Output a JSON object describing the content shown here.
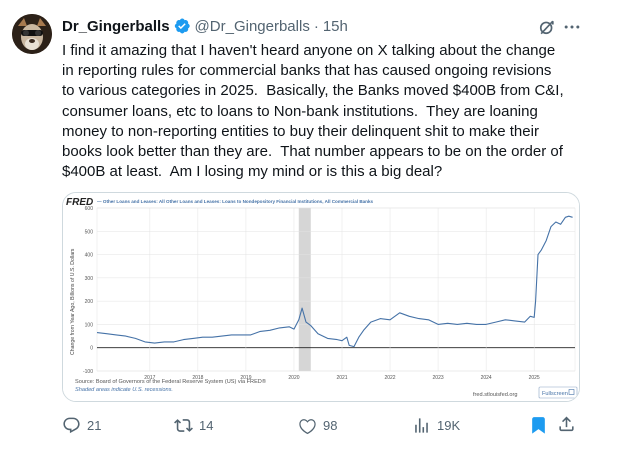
{
  "tweet": {
    "display_name": "Dr_Gingerballs",
    "handle": "@Dr_Gingerballs",
    "separator": "·",
    "time": "15h",
    "text": "I find it amazing that I haven't heard anyone on X talking about the change\nin reporting rules for commercial banks that has caused ongoing revisions\nto various categories in 2025.  Basically, the Banks moved $400B from C&I,\nconsumer loans, etc to loans to Non-bank institutions.  They are loaning\nmoney to non-reporting entities to buy their delinquent shit to make their\nbooks look better than they are.  That number appears to be on the order of\n$400B at least.  Am I losing my mind or is this a big deal?",
    "verified_color": "#1d9bf0"
  },
  "chart": {
    "logo": "FRED",
    "legend": "— Other Loans and Leases: All Other Loans and Leases: Loans to Nondepository Financial Institutions, All Commercial Banks",
    "ylabel": "Change from Year Ago, Billions of U.S. Dollars",
    "source": "Source: Board of Governors of the Federal Reserve System (US) via FRED®",
    "shaded_note": "Shaded areas indicate U.S. recessions.",
    "site": "fred.stlouisfed.org",
    "fullscreen_label": "Fullscreen",
    "line_color": "#4572a7",
    "recession_color": "#cccccc"
  },
  "chart_data": {
    "type": "line",
    "title": "Other Loans and Leases: All Other Loans and Leases: Loans to Nondepository Financial Institutions, All Commercial Banks",
    "ylabel": "Change from Year Ago, Billions of U.S. Dollars",
    "xlabel": "",
    "ylim": [
      -100,
      600
    ],
    "yticks": [
      -100,
      0,
      100,
      200,
      300,
      400,
      500,
      600
    ],
    "xticks": [
      "2017",
      "2018",
      "2019",
      "2020",
      "2021",
      "2022",
      "2023",
      "2024",
      "2025"
    ],
    "xlim": [
      2015.9,
      2025.85
    ],
    "recession": [
      2020.1,
      2020.35
    ],
    "grid": true,
    "series": [
      {
        "x": [
          2015.9,
          2016.1,
          2016.3,
          2016.5,
          2016.7,
          2016.9,
          2017.1,
          2017.3,
          2017.5,
          2017.7,
          2017.9,
          2018.1,
          2018.3,
          2018.5,
          2018.7,
          2018.9,
          2019.1,
          2019.3,
          2019.5,
          2019.7,
          2019.9,
          2020.0,
          2020.1,
          2020.17,
          2020.25,
          2020.35,
          2020.5,
          2020.7,
          2020.9,
          2021.0,
          2021.1,
          2021.15,
          2021.25,
          2021.35,
          2021.45,
          2021.6,
          2021.8,
          2022.0,
          2022.2,
          2022.4,
          2022.6,
          2022.8,
          2023.0,
          2023.2,
          2023.4,
          2023.6,
          2023.8,
          2024.0,
          2024.2,
          2024.4,
          2024.6,
          2024.8,
          2024.92,
          2025.0,
          2025.03,
          2025.08,
          2025.15,
          2025.25,
          2025.35,
          2025.45,
          2025.55,
          2025.65,
          2025.72,
          2025.8
        ],
        "y": [
          65,
          60,
          55,
          50,
          40,
          25,
          20,
          25,
          25,
          35,
          40,
          45,
          45,
          50,
          55,
          55,
          55,
          70,
          75,
          85,
          90,
          80,
          120,
          170,
          110,
          95,
          60,
          40,
          35,
          30,
          45,
          10,
          5,
          45,
          75,
          110,
          125,
          120,
          150,
          135,
          125,
          120,
          100,
          105,
          100,
          105,
          100,
          100,
          110,
          120,
          115,
          110,
          135,
          130,
          200,
          400,
          420,
          460,
          520,
          540,
          530,
          560,
          565,
          560
        ]
      }
    ]
  },
  "actions": {
    "replies": "21",
    "reposts": "14",
    "likes": "98",
    "views": "19K"
  }
}
